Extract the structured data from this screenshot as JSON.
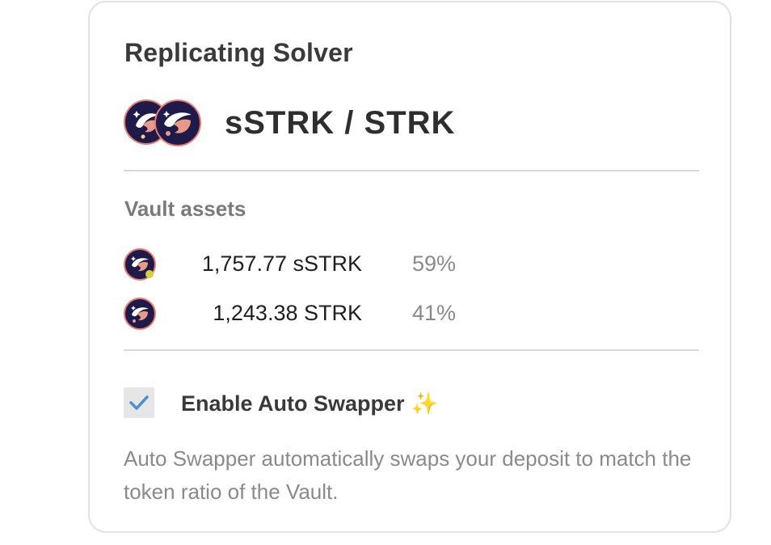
{
  "card": {
    "title": "Replicating Solver",
    "pair": {
      "name": "sSTRK / STRK",
      "icons": [
        "sstrk-token-icon",
        "strk-token-icon"
      ]
    },
    "vault_assets": {
      "label": "Vault assets",
      "items": [
        {
          "amount": "1,757.77 sSTRK",
          "percent": "59%",
          "icon": "sstrk-token-icon"
        },
        {
          "amount": "1,243.38 STRK",
          "percent": "41%",
          "icon": "strk-token-icon"
        }
      ]
    },
    "auto_swapper": {
      "label": "Enable Auto Swapper",
      "emoji": "✨",
      "checked": true,
      "description": "Auto Swapper automatically swaps your deposit to match the token ratio of the Vault."
    }
  },
  "colors": {
    "accent_check": "#4a90d9",
    "token_bg": "#1e1a4a",
    "token_ring": "#e87a70",
    "muted_text": "#8a8a8a"
  }
}
